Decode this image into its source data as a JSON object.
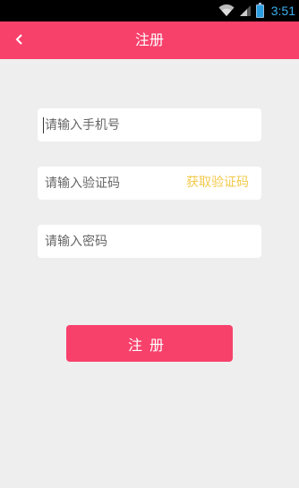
{
  "status_bar": {
    "time": "3:51",
    "icons": [
      "wifi-icon",
      "signal-icon",
      "battery-icon"
    ]
  },
  "header": {
    "title": "注册",
    "back_icon": "chevron-left-icon",
    "background_color": "#f7416b"
  },
  "form": {
    "phone": {
      "placeholder": "请输入手机号",
      "value": ""
    },
    "code": {
      "placeholder": "请输入验证码",
      "value": "",
      "action_label": "获取验证码",
      "action_color": "#f2c94c"
    },
    "password": {
      "placeholder": "请输入密码",
      "value": ""
    }
  },
  "submit": {
    "label": "注册",
    "color": "#f7416b"
  }
}
